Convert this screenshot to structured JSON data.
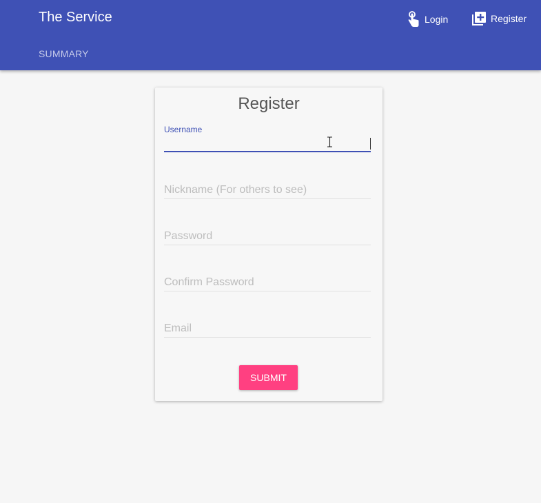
{
  "header": {
    "title": "The Service",
    "login_label": "Login",
    "register_label": "Register",
    "login_icon": "touch-hand-icon",
    "register_icon": "library-add-icon",
    "subnav_label": "SUMMARY",
    "background_color": "#3f51b5"
  },
  "form": {
    "title": "Register",
    "fields": [
      {
        "label": "Username",
        "value": "",
        "focused": true
      },
      {
        "placeholder": "Nickname (For others to see)",
        "value": ""
      },
      {
        "placeholder": "Password",
        "value": ""
      },
      {
        "placeholder": "Confirm Password",
        "value": ""
      },
      {
        "placeholder": "Email",
        "value": ""
      }
    ],
    "submit_label": "SUBMIT",
    "submit_color": "#ff4081"
  }
}
